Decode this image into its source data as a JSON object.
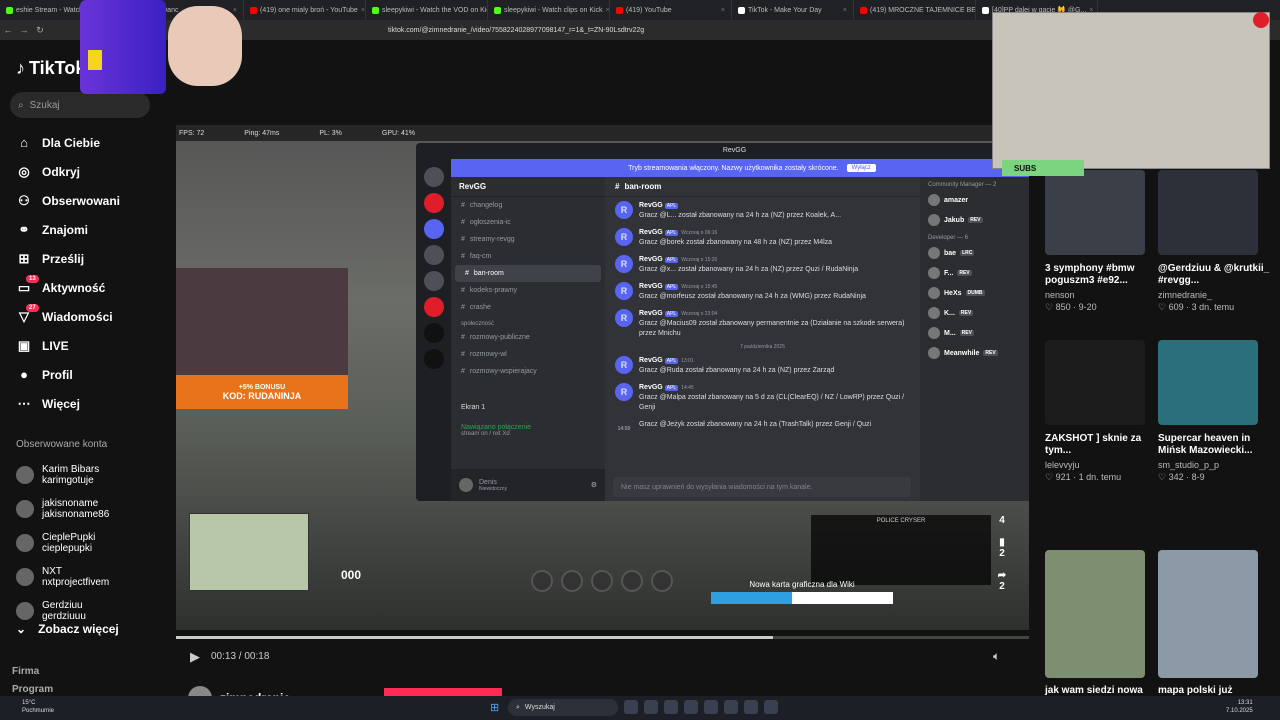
{
  "browser": {
    "tabs": [
      {
        "label": "eshie Stream - Watch",
        "color": "#53fc18"
      },
      {
        "label": "NAPI A Danc",
        "color": "#ff0000"
      },
      {
        "label": "(419) one mialy broń - YouTube",
        "color": "#ff0000"
      },
      {
        "label": "sleepykiwi - Watch the VOD on Kick",
        "color": "#53fc18"
      },
      {
        "label": "sleepykiwi - Watch clips on Kick",
        "color": "#53fc18"
      },
      {
        "label": "(419) YouTube",
        "color": "#ff0000"
      },
      {
        "label": "TikTok - Make Your Day",
        "color": "#ffffff"
      },
      {
        "label": "(419) MROCZNE TAJEMNICE BETEL",
        "color": "#ff0000"
      },
      {
        "label": "[40]PP dalej w gacie 🙀 @G...",
        "color": "#ffffff"
      }
    ],
    "url": "tiktok.com/@zimnedranie_/video/7558224028977098147_r=1&_t=ZN-90Lsdtrv22g"
  },
  "tiktok": {
    "logo": "TikTok",
    "search_placeholder": "Szukaj",
    "menu": [
      {
        "label": "Dla Ciebie",
        "icon": "home-icon",
        "glyph": "⌂"
      },
      {
        "label": "Odkryj",
        "icon": "compass-icon",
        "glyph": "◎"
      },
      {
        "label": "Obserwowani",
        "icon": "following-icon",
        "glyph": "⚇"
      },
      {
        "label": "Znajomi",
        "icon": "friends-icon",
        "glyph": "⚭"
      },
      {
        "label": "Prześlij",
        "icon": "upload-icon",
        "glyph": "⊞"
      },
      {
        "label": "Aktywność",
        "icon": "activity-icon",
        "glyph": "▭",
        "badge": "13"
      },
      {
        "label": "Wiadomości",
        "icon": "messages-icon",
        "glyph": "▽",
        "badge": "27"
      },
      {
        "label": "LIVE",
        "icon": "live-icon",
        "glyph": "▣"
      },
      {
        "label": "Profil",
        "icon": "avatar",
        "glyph": "●"
      },
      {
        "label": "Więcej",
        "icon": "more-icon",
        "glyph": "⋯"
      }
    ],
    "followed_title": "Obserwowane konta",
    "followed": [
      {
        "name": "Karim Bibars",
        "handle": "karimgotuje"
      },
      {
        "name": "jakisnoname",
        "handle": "jakisnoname86"
      },
      {
        "name": "CieplePupki",
        "handle": "cieplepupki"
      },
      {
        "name": "NXT",
        "handle": "nxtprojectfivem"
      },
      {
        "name": "Gerdziuu",
        "handle": "gerdziuuu"
      }
    ],
    "see_more": "Zobacz więcej",
    "footer": [
      "Firma",
      "Program"
    ]
  },
  "video": {
    "hud": [
      "FPS: 72",
      "Ping: 47ms",
      "PL: 3%",
      "GPU: 41%"
    ],
    "banner_top": "+5% BONUSU",
    "banner_code": "KOD: RUDANINJA",
    "speed": "000",
    "wiki_label": "Nowa karta graficzna dla Wiki",
    "wiki_progress": "200.29 / 450.00 (44.57%)",
    "wiki_progress_pct": 44.57,
    "police_label": "POLICE CRYSER",
    "time": "00:13 / 00:18",
    "progress_fraction": 0.7,
    "author": "zimnedranie"
  },
  "discord": {
    "window_title": "RevGG",
    "streaming_banner": "Tryb streamowania włączony. Nazwy użytkownika zostały skrócone.",
    "streaming_button": "Wyłącz",
    "server_name": "RevGG",
    "channels": [
      "changelog",
      "ogłoszenia-ic",
      "streamy-revgg",
      "faq-cm",
      "ban-room",
      "kodeks-prawny",
      "crashe"
    ],
    "category": "społeczność",
    "channels2": [
      "rozmowy-publiczne",
      "rozmowy-wl",
      "rozmowy-wspierajacy"
    ],
    "screen_label": "Ekran 1",
    "voice_status": "Nawiązano połączenie",
    "voice_sub": "stream on / nxt Xd",
    "user": "Denis",
    "user_status": "Niewidoczny",
    "chat_channel": "ban-room",
    "messages": [
      {
        "author": "RevGG",
        "time": "",
        "text": "Gracz @L... został zbanowany na 24 h za (NZ) przez Koalek, A..."
      },
      {
        "author": "RevGG",
        "time": "Wczoraj o 06:16",
        "text": "Gracz @borek został zbanowany na 48 h za (NZ) przez M4lza"
      },
      {
        "author": "RevGG",
        "time": "Wczoraj o 15:20",
        "text": "Gracz @x... został zbanowany na 24 h za (NZ) przez Quzi / RudaNinja"
      },
      {
        "author": "RevGG",
        "time": "Wczoraj o 15:45",
        "text": "Gracz @morfeusz został zbanowany na 24 h za (WMG) przez RudaNinja"
      },
      {
        "author": "RevGG",
        "time": "Wczoraj o 23:04",
        "text": "Gracz @Macius09 został zbanowany permanentnie za (Działanie na szkode serwera) przez Mnichu"
      },
      {
        "author": "RevGG",
        "time": "13:01",
        "text": "Gracz @Ruda został zbanowany na 24 h za (NZ) przez Zarząd"
      },
      {
        "author": "RevGG",
        "time": "14:45",
        "text": "Gracz @Malpa został zbanowany na 5 d za (CL(ClearEQ) / NZ / LowRP) przez Quzi / Genji"
      },
      {
        "author": "",
        "time": "14:50",
        "text": "Gracz @Jeżyk został zbanowany na 24 h za (TrashTalk) przez Genji / Quzi"
      }
    ],
    "date_divider": "7 października 2025",
    "input_placeholder": "Nie masz uprawnień do wysyłania wiadomości na tym kanale.",
    "members_categories": [
      {
        "title": "Community Manager — 2",
        "members": [
          {
            "name": "amazer",
            "role": ""
          },
          {
            "name": "Jakub",
            "role": "REV"
          }
        ]
      },
      {
        "title": "Developer — 6",
        "members": [
          {
            "name": "bae",
            "role": "LRC"
          },
          {
            "name": "F...",
            "role": "REV"
          },
          {
            "name": "HeXs",
            "role": "DUMB"
          },
          {
            "name": "K...",
            "role": "REV"
          },
          {
            "name": "M...",
            "role": "REV"
          },
          {
            "name": "Meanwhile",
            "role": "REV"
          }
        ]
      }
    ]
  },
  "rail": [
    "4",
    "2",
    "2"
  ],
  "grid": [
    {
      "caption": "3 symphony #bmw poguszm3 #e92...",
      "user": "nenson",
      "stats": "850 · 9-20"
    },
    {
      "caption": "@Gerdziuu & @krutkii_ #revgg...",
      "user": "zimnedranie_",
      "stats": "609 · 3 dn. temu"
    },
    {
      "caption": "ZAKSHOT ] sknie za tym...",
      "user": "lelevvyju",
      "stats": "921 · 1 dn. temu"
    },
    {
      "caption": "Supercar heaven in Mińsk Mazowiecki...",
      "user": "sm_studio_p_p",
      "stats": "342 · 8-9"
    },
    {
      "caption": "jak wam siedzi nowa",
      "user": "",
      "stats": ""
    },
    {
      "caption": "mapa polski już",
      "user": "",
      "stats": ""
    }
  ],
  "webcam": {
    "subs": "SUBS"
  },
  "taskbar": {
    "weather_temp": "15°C",
    "weather_desc": "Pochmurnie",
    "search": "Wyszukaj",
    "time": "13:31",
    "date": "7.10.2025"
  }
}
